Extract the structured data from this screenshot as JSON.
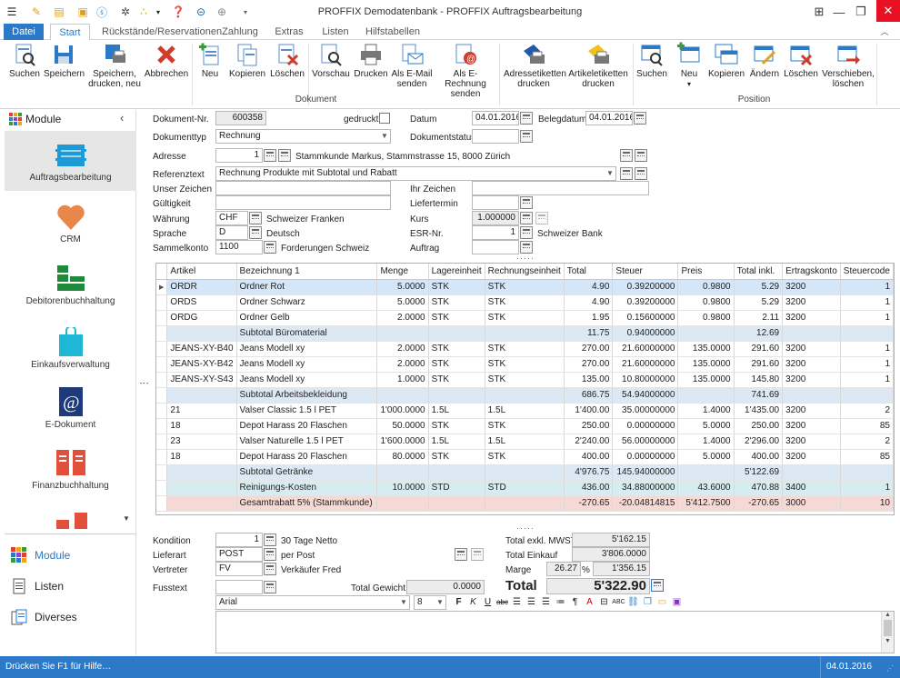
{
  "window": {
    "title": "PROFFIX Demodatenbank - PROFFIX Auftragsbearbeitung"
  },
  "ribbon": {
    "tabs": [
      "Datei",
      "Start",
      "Rückstände/Reservationen",
      "Zahlung",
      "Extras",
      "Listen",
      "Hilfstabellen"
    ],
    "dokument": {
      "group_label": "Dokument",
      "buttons": [
        "Suchen",
        "Speichern",
        "Speichern, drucken, neu",
        "Abbrechen",
        "Neu",
        "Kopieren",
        "Löschen",
        "Vorschau",
        "Drucken",
        "Als E-Mail senden",
        "Als E-Rechnung senden",
        "Adressetiketten drucken",
        "Artikeletiketten drucken"
      ]
    },
    "position": {
      "group_label": "Position",
      "buttons": [
        "Suchen",
        "Neu",
        "Kopieren",
        "Ändern",
        "Löschen",
        "Verschieben, löschen"
      ]
    }
  },
  "sidebar": {
    "header": "Module",
    "modules": [
      "Auftragsbearbeitung",
      "CRM",
      "Debitorenbuchhaltung",
      "Einkaufsverwaltung",
      "E-Dokument",
      "Finanzbuchhaltung"
    ],
    "nav": [
      "Module",
      "Listen",
      "Diverses"
    ]
  },
  "header": {
    "dokument_nr_label": "Dokument-Nr.",
    "dokument_nr": "600358",
    "gedruckt_label": "gedruckt",
    "datum_label": "Datum",
    "datum": "04.01.2016",
    "belegdatum_label": "Belegdatum",
    "belegdatum": "04.01.2016",
    "dokumenttyp_label": "Dokumenttyp",
    "dokumenttyp": "Rechnung",
    "dokumentstatus_label": "Dokumentstatus",
    "dokumentstatus": "",
    "adresse_label": "Adresse",
    "adresse_nr": "1",
    "adresse_text": "Stammkunde Markus, Stammstrasse 15, 8000 Zürich",
    "referenztext_label": "Referenztext",
    "referenztext": "Rechnung Produkte mit Subtotal und Rabatt",
    "unser_zeichen_label": "Unser Zeichen",
    "unser_zeichen": "",
    "ihr_zeichen_label": "Ihr Zeichen",
    "ihr_zeichen": "",
    "gueltigkeit_label": "Gültigkeit",
    "gueltigkeit": "",
    "liefertermin_label": "Liefertermin",
    "liefertermin": "",
    "waehrung_label": "Währung",
    "waehrung": "CHF",
    "waehrung_text": "Schweizer Franken",
    "kurs_label": "Kurs",
    "kurs": "1.000000",
    "sprache_label": "Sprache",
    "sprache": "D",
    "sprache_text": "Deutsch",
    "esr_label": "ESR-Nr.",
    "esr": "1",
    "esr_text": "Schweizer Bank",
    "sammelkonto_label": "Sammelkonto",
    "sammelkonto": "1100",
    "sammelkonto_text": "Forderungen Schweiz",
    "auftrag_label": "Auftrag",
    "auftrag": ""
  },
  "grid": {
    "columns": [
      "Artikel",
      "Bezeichnung 1",
      "Menge",
      "Lagereinheit",
      "Rechnungseinheit",
      "Total",
      "Steuer",
      "Preis",
      "Total inkl.",
      "Ertragskonto",
      "Steuercode"
    ],
    "rows": [
      {
        "type": "sel",
        "cells": [
          "ORDR",
          "Ordner Rot",
          "5.0000",
          "STK",
          "STK",
          "4.90",
          "0.39200000",
          "0.9800",
          "5.29",
          "3200",
          "1"
        ]
      },
      {
        "type": "item",
        "cells": [
          "ORDS",
          "Ordner Schwarz",
          "5.0000",
          "STK",
          "STK",
          "4.90",
          "0.39200000",
          "0.9800",
          "5.29",
          "3200",
          "1"
        ]
      },
      {
        "type": "item",
        "cells": [
          "ORDG",
          "Ordner Gelb",
          "2.0000",
          "STK",
          "STK",
          "1.95",
          "0.15600000",
          "0.9800",
          "2.11",
          "3200",
          "1"
        ]
      },
      {
        "type": "sub",
        "cells": [
          "",
          "Subtotal Büromaterial",
          "",
          "",
          "",
          "11.75",
          "0.94000000",
          "",
          "12.69",
          "",
          ""
        ]
      },
      {
        "type": "item",
        "cells": [
          "JEANS-XY-B40",
          "Jeans Modell xy",
          "2.0000",
          "STK",
          "STK",
          "270.00",
          "21.60000000",
          "135.0000",
          "291.60",
          "3200",
          "1"
        ]
      },
      {
        "type": "item",
        "cells": [
          "JEANS-XY-B42",
          "Jeans Modell xy",
          "2.0000",
          "STK",
          "STK",
          "270.00",
          "21.60000000",
          "135.0000",
          "291.60",
          "3200",
          "1"
        ]
      },
      {
        "type": "item",
        "cells": [
          "JEANS-XY-S43",
          "Jeans Modell xy",
          "1.0000",
          "STK",
          "STK",
          "135.00",
          "10.80000000",
          "135.0000",
          "145.80",
          "3200",
          "1"
        ]
      },
      {
        "type": "sub",
        "cells": [
          "",
          "Subtotal Arbeitsbekleidung",
          "",
          "",
          "",
          "686.75",
          "54.94000000",
          "",
          "741.69",
          "",
          ""
        ]
      },
      {
        "type": "item",
        "cells": [
          "21",
          "Valser Classic 1.5 l PET",
          "1'000.0000",
          "1.5L",
          "1.5L",
          "1'400.00",
          "35.00000000",
          "1.4000",
          "1'435.00",
          "3200",
          "2"
        ]
      },
      {
        "type": "item",
        "cells": [
          "18",
          "Depot Harass 20 Flaschen",
          "50.0000",
          "STK",
          "STK",
          "250.00",
          "0.00000000",
          "5.0000",
          "250.00",
          "3200",
          "85"
        ]
      },
      {
        "type": "item",
        "cells": [
          "23",
          "Valser Naturelle 1.5 l PET",
          "1'600.0000",
          "1.5L",
          "1.5L",
          "2'240.00",
          "56.00000000",
          "1.4000",
          "2'296.00",
          "3200",
          "2"
        ]
      },
      {
        "type": "item",
        "cells": [
          "18",
          "Depot Harass 20 Flaschen",
          "80.0000",
          "STK",
          "STK",
          "400.00",
          "0.00000000",
          "5.0000",
          "400.00",
          "3200",
          "85"
        ]
      },
      {
        "type": "sub",
        "cells": [
          "",
          "Subtotal Getränke",
          "",
          "",
          "",
          "4'976.75",
          "145.94000000",
          "",
          "5'122.69",
          "",
          ""
        ]
      },
      {
        "type": "reinig",
        "cells": [
          "",
          "Reinigungs-Kosten",
          "10.0000",
          "STD",
          "STD",
          "436.00",
          "34.88000000",
          "43.6000",
          "470.88",
          "3400",
          "1"
        ]
      },
      {
        "type": "rabatt",
        "cells": [
          "",
          "Gesamtrabatt 5% (Stammkunde)",
          "",
          "",
          "",
          "-270.65",
          "-20.04814815",
          "5'412.7500",
          "-270.65",
          "3000",
          "10"
        ]
      }
    ]
  },
  "footer": {
    "kondition_label": "Kondition",
    "kondition": "1",
    "kondition_text": "30 Tage Netto",
    "lieferart_label": "Lieferart",
    "lieferart": "POST",
    "lieferart_text": "per Post",
    "vertreter_label": "Vertreter",
    "vertreter": "FV",
    "vertreter_text": "Verkäufer Fred",
    "fusstext_label": "Fusstext",
    "fusstext": "",
    "total_gewicht_label": "Total Gewicht",
    "total_gewicht": "0.0000",
    "total_exkl_label": "Total exkl. MWST",
    "total_exkl": "5'162.15",
    "total_einkauf_label": "Total Einkauf",
    "total_einkauf": "3'806.0000",
    "marge_label": "Marge",
    "marge_pct": "26.27",
    "marge_pct_sign": "%",
    "marge": "1'356.15",
    "total_label": "Total",
    "total": "5'322.90",
    "font": "Arial",
    "font_size": "8"
  },
  "statusbar": {
    "help": "Drücken Sie F1 für Hilfe…",
    "date": "04.01.2016"
  }
}
